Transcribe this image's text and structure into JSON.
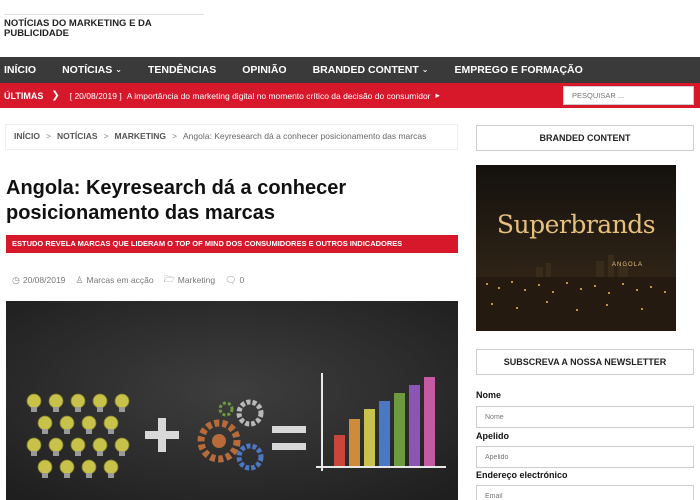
{
  "site": {
    "title": "NOTÍCIAS DO MARKETING E DA PUBLICIDADE"
  },
  "nav": {
    "items": [
      {
        "label": "INÍCIO",
        "dropdown": false
      },
      {
        "label": "NOTÍCIAS",
        "dropdown": true
      },
      {
        "label": "TENDÊNCIAS",
        "dropdown": false
      },
      {
        "label": "OPINIÃO",
        "dropdown": false
      },
      {
        "label": "BRANDED CONTENT",
        "dropdown": true
      },
      {
        "label": "EMPREGO E FORMAÇÃO",
        "dropdown": false
      }
    ]
  },
  "ticker": {
    "label": "ÚLTIMAS",
    "date": "[ 20/08/2019 ]",
    "headline": "A importância do marketing digital no momento crítico da decisão do consumidor",
    "search_placeholder": "PESQUISAR ..."
  },
  "breadcrumb": {
    "home": "INÍCIO",
    "section": "NOTÍCIAS",
    "category": "MARKETING",
    "current": "Angola: Keyresearch dá a conhecer posicionamento das marcas"
  },
  "article": {
    "title": "Angola: Keyresearch dá a conhecer posicionamento das marcas",
    "subtitle": "ESTUDO REVELA MARCAS QUE LIDERAM O TOP OF MIND DOS CONSUMIDORES E OUTROS INDICADORES",
    "date": "20/08/2019",
    "author": "Marcas em acção",
    "category": "Marketing",
    "comments": "0"
  },
  "sidebar": {
    "branded_title": "BRANDED CONTENT",
    "promo_title": "Superbrands",
    "promo_sub": "ANGOLA",
    "newsletter_title": "SUBSCREVA A NOSSA NEWSLETTER",
    "fields": [
      {
        "label": "Nome",
        "placeholder": "Nome"
      },
      {
        "label": "Apelido",
        "placeholder": "Apelido"
      },
      {
        "label": "Endereço electrónico",
        "placeholder": "Email"
      }
    ]
  },
  "colors": {
    "accent_red": "#d7182a",
    "nav_bg": "#3a3a3a",
    "promo_gold": "#e7c07c"
  },
  "icons": {
    "date": "clock-icon",
    "author": "user-icon",
    "category": "folder-icon",
    "comments": "comment-icon",
    "ticker": "chevron-right-icon"
  }
}
